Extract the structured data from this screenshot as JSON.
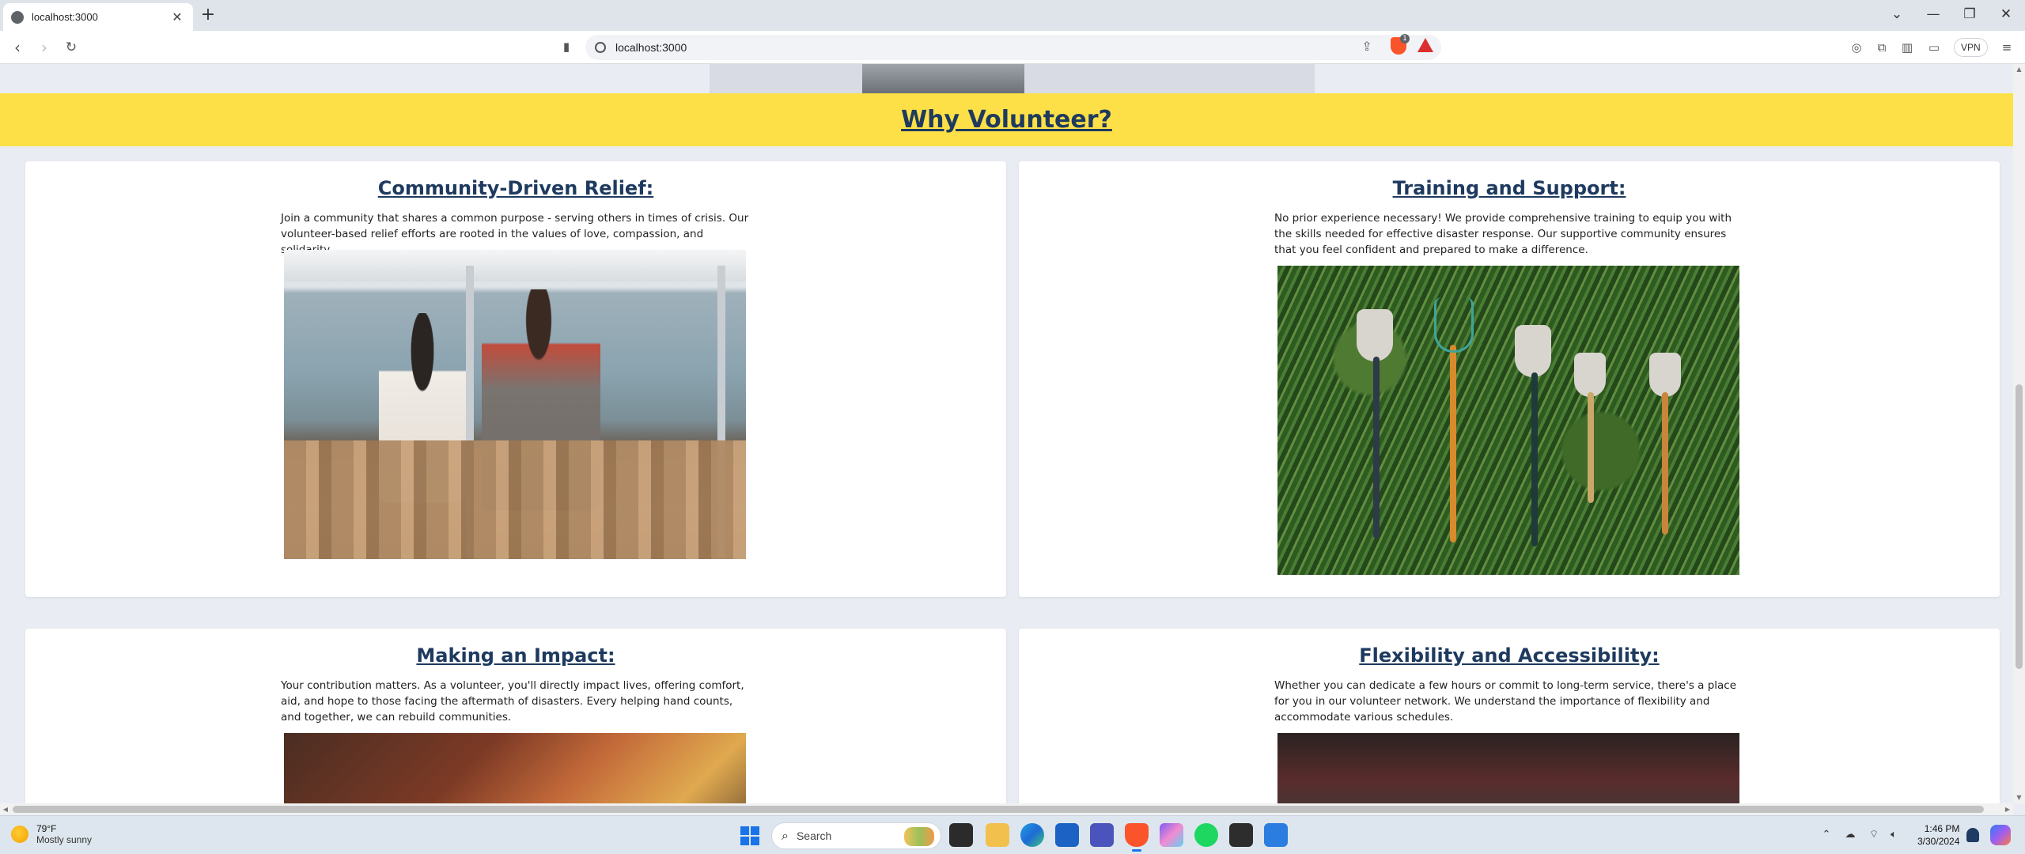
{
  "browser": {
    "tab_title": "localhost:3000",
    "tab_close": "✕",
    "new_tab": "+",
    "url": "localhost:3000",
    "vpn_label": "VPN",
    "shield_count": "1",
    "window_controls": [
      "⌄",
      "—",
      "❐",
      "✕"
    ]
  },
  "page": {
    "section_title": "Why Volunteer?",
    "cards": [
      {
        "title": "Community-Driven Relief:",
        "text": "Join a community that shares a common purpose - serving others in times of crisis. Our volunteer-based relief efforts are rooted in the values of love, compassion, and solidarity."
      },
      {
        "title": "Training and Support:",
        "text": "No prior experience necessary! We provide comprehensive training to equip you with the skills needed for effective disaster response. Our supportive community ensures that you feel confident and prepared to make a difference."
      },
      {
        "title": "Making an Impact:",
        "text": "Your contribution matters. As a volunteer, you'll directly impact lives, offering comfort, aid, and hope to those facing the aftermath of disasters. Every helping hand counts, and together, we can rebuild communities."
      },
      {
        "title": "Flexibility and Accessibility:",
        "text": "Whether you can dedicate a few hours or commit to long-term service, there's a place for you in our volunteer network. We understand the importance of flexibility and accommodate various schedules."
      }
    ]
  },
  "taskbar": {
    "weather_temp": "79°F",
    "weather_desc": "Mostly sunny",
    "search_label": "Search",
    "time": "1:46 PM",
    "date": "3/30/2024"
  },
  "colors": {
    "banner": "#fde047",
    "heading": "#1e3a5f",
    "page_bg": "#e9edf3",
    "card_bg": "#ffffff"
  }
}
